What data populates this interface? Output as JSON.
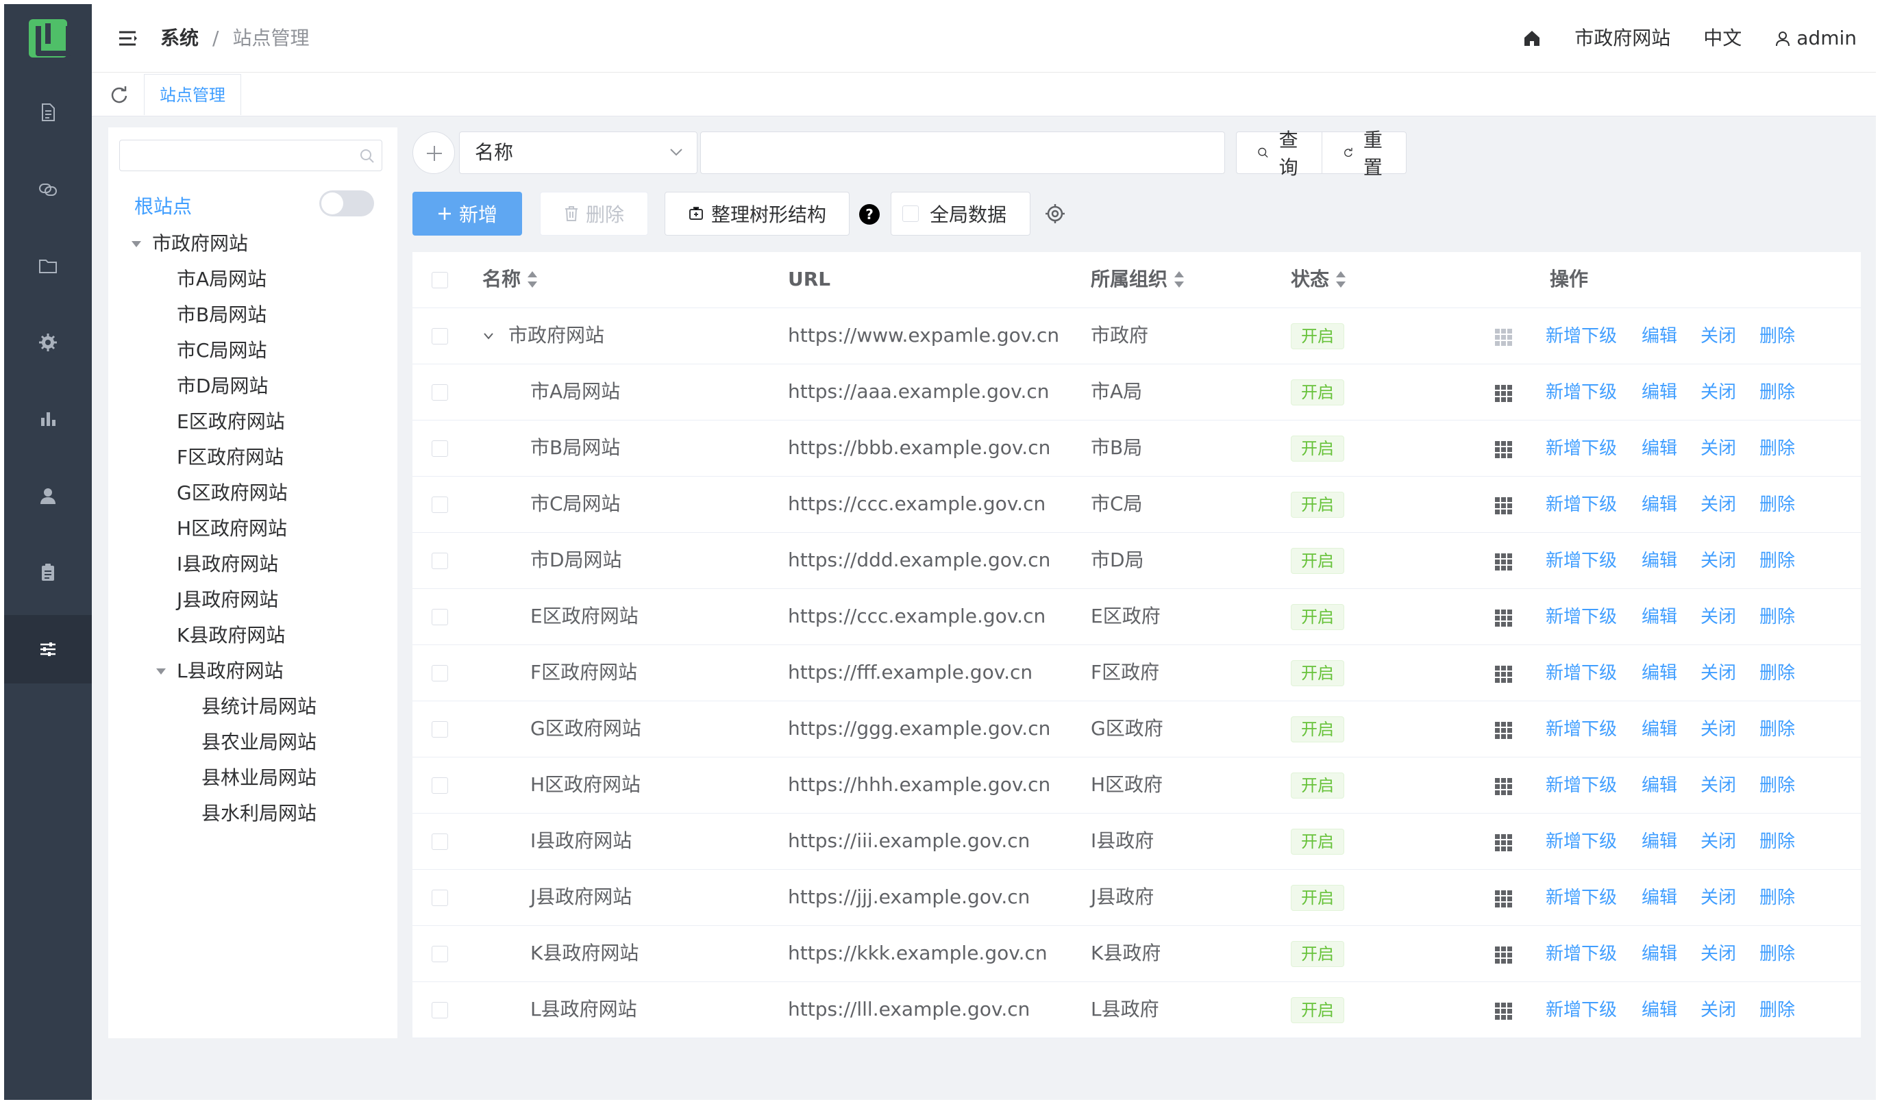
{
  "header": {
    "breadcrumb_parent": "系统",
    "breadcrumb_separator": "/",
    "breadcrumb_current": "站点管理",
    "site_name": "市政府网站",
    "language": "中文",
    "username": "admin"
  },
  "tags": {
    "active_tab": "站点管理"
  },
  "rail": {
    "items": [
      "document-icon",
      "link-icon",
      "folder-icon",
      "settings-icon",
      "chart-icon",
      "user-icon",
      "clipboard-icon",
      "sliders-icon"
    ],
    "active_index": 7
  },
  "tree": {
    "search_placeholder": "",
    "root_label": "根站点",
    "nodes": [
      {
        "label": "市政府网站",
        "level": 0,
        "expanded": true
      },
      {
        "label": "市A局网站",
        "level": 1
      },
      {
        "label": "市B局网站",
        "level": 1
      },
      {
        "label": "市C局网站",
        "level": 1
      },
      {
        "label": "市D局网站",
        "level": 1
      },
      {
        "label": "E区政府网站",
        "level": 1
      },
      {
        "label": "F区政府网站",
        "level": 1
      },
      {
        "label": "G区政府网站",
        "level": 1
      },
      {
        "label": "H区政府网站",
        "level": 1
      },
      {
        "label": "I县政府网站",
        "level": 1
      },
      {
        "label": "J县政府网站",
        "level": 1
      },
      {
        "label": "K县政府网站",
        "level": 1
      },
      {
        "label": "L县政府网站",
        "level": 1,
        "expanded": true
      },
      {
        "label": "县统计局网站",
        "level": 2
      },
      {
        "label": "县农业局网站",
        "level": 2
      },
      {
        "label": "县林业局网站",
        "level": 2
      },
      {
        "label": "县水利局网站",
        "level": 2
      }
    ]
  },
  "filter": {
    "field_select": "名称",
    "value": "",
    "search_label": "查询",
    "reset_label": "重置"
  },
  "toolbar": {
    "add_label": "新增",
    "delete_label": "删除",
    "tree_label": "整理树形结构",
    "help": "?",
    "global_data_label": "全局数据"
  },
  "table": {
    "headers": {
      "name": "名称",
      "url": "URL",
      "org": "所属组织",
      "status": "状态",
      "actions": "操作"
    },
    "action_labels": {
      "add_child": "新增下级",
      "edit": "编辑",
      "close": "关闭",
      "delete": "删除"
    },
    "rows": [
      {
        "name": "市政府网站",
        "url": "https://www.expamle.gov.cn",
        "org": "市政府",
        "status": "开启",
        "level": 0,
        "expanded": true
      },
      {
        "name": "市A局网站",
        "url": "https://aaa.example.gov.cn",
        "org": "市A局",
        "status": "开启",
        "level": 1
      },
      {
        "name": "市B局网站",
        "url": "https://bbb.example.gov.cn",
        "org": "市B局",
        "status": "开启",
        "level": 1
      },
      {
        "name": "市C局网站",
        "url": "https://ccc.example.gov.cn",
        "org": "市C局",
        "status": "开启",
        "level": 1
      },
      {
        "name": "市D局网站",
        "url": "https://ddd.example.gov.cn",
        "org": "市D局",
        "status": "开启",
        "level": 1
      },
      {
        "name": "E区政府网站",
        "url": "https://ccc.example.gov.cn",
        "org": "E区政府",
        "status": "开启",
        "level": 1
      },
      {
        "name": "F区政府网站",
        "url": "https://fff.example.gov.cn",
        "org": "F区政府",
        "status": "开启",
        "level": 1
      },
      {
        "name": "G区政府网站",
        "url": "https://ggg.example.gov.cn",
        "org": "G区政府",
        "status": "开启",
        "level": 1
      },
      {
        "name": "H区政府网站",
        "url": "https://hhh.example.gov.cn",
        "org": "H区政府",
        "status": "开启",
        "level": 1
      },
      {
        "name": "I县政府网站",
        "url": "https://iii.example.gov.cn",
        "org": "I县政府",
        "status": "开启",
        "level": 1
      },
      {
        "name": "J县政府网站",
        "url": "https://jjj.example.gov.cn",
        "org": "J县政府",
        "status": "开启",
        "level": 1
      },
      {
        "name": "K县政府网站",
        "url": "https://kkk.example.gov.cn",
        "org": "K县政府",
        "status": "开启",
        "level": 1
      },
      {
        "name": "L县政府网站",
        "url": "https://lll.example.gov.cn",
        "org": "L县政府",
        "status": "开启",
        "level": 1
      }
    ]
  },
  "colors": {
    "primary": "#409eff",
    "rail_bg": "#333d4b",
    "success": "#67c23a",
    "logo": "#4fbf68"
  }
}
